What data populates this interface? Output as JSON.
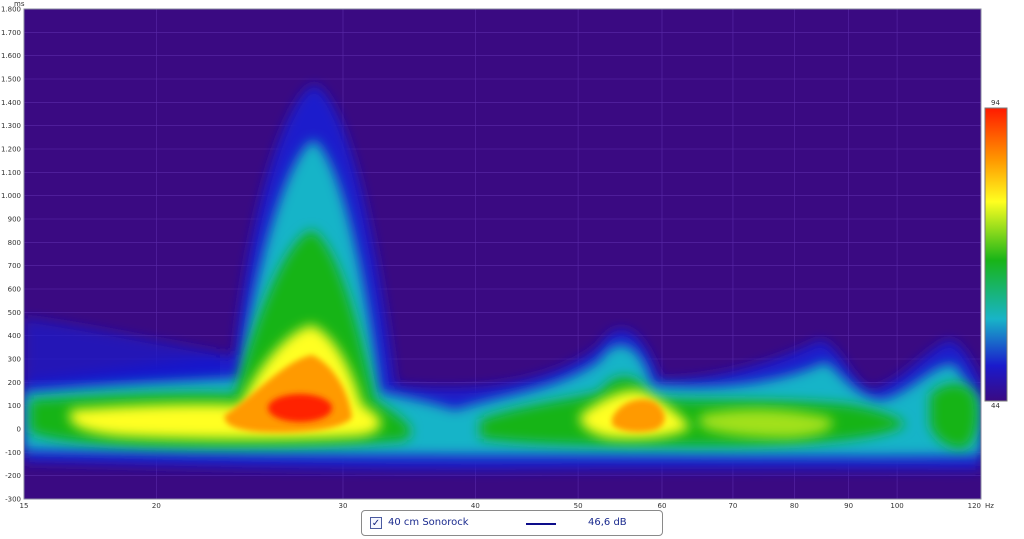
{
  "chart_data": {
    "type": "heatmap",
    "title": "",
    "x_axis": {
      "scale": "log",
      "unit": "Hz",
      "range": [
        15,
        120
      ],
      "ticks": [
        "15",
        "20",
        "30",
        "40",
        "50",
        "60",
        "70",
        "80",
        "90",
        "100",
        "120"
      ]
    },
    "y_axis": {
      "scale": "linear",
      "unit": "ms",
      "range": [
        -300,
        1800
      ],
      "ticks": [
        "-300",
        "-200",
        "-100",
        "0",
        "100",
        "200",
        "300",
        "400",
        "500",
        "600",
        "700",
        "800",
        "900",
        "1.000",
        "1.100",
        "1.200",
        "1.300",
        "1.400",
        "1.500",
        "1.600",
        "1.700",
        "1.800"
      ]
    },
    "colorbar": {
      "max_label": "94",
      "min_label": "44",
      "min": 44,
      "max": 94
    },
    "colors": {
      "background": "#3a0a82",
      "low": "#1a1acc",
      "mid": "#10b020",
      "high": "#ffff20",
      "peak": "#ff2000"
    },
    "series": [
      {
        "name": "40 cm Sonorock",
        "legend_value": "46,6 dB",
        "color": "#0d0d8a"
      }
    ],
    "features": [
      {
        "freq_hz": 28,
        "time_ms": 100,
        "peak_db": 93,
        "decay_to_ms": 1450
      },
      {
        "freq_hz": 57,
        "time_ms": 50,
        "peak_db": 88,
        "decay_to_ms": 450
      },
      {
        "freq_hz": 18,
        "time_ms": 50,
        "peak_db": 78,
        "decay_to_ms": 150
      },
      {
        "freq_hz": 75,
        "time_ms": 30,
        "peak_db": 74,
        "decay_to_ms": 200
      },
      {
        "freq_hz": 117,
        "time_ms": 50,
        "peak_db": 74,
        "decay_to_ms": 250
      }
    ],
    "grid": true,
    "legend_position": "bottom-center",
    "checkbox": {
      "checked": true
    }
  }
}
